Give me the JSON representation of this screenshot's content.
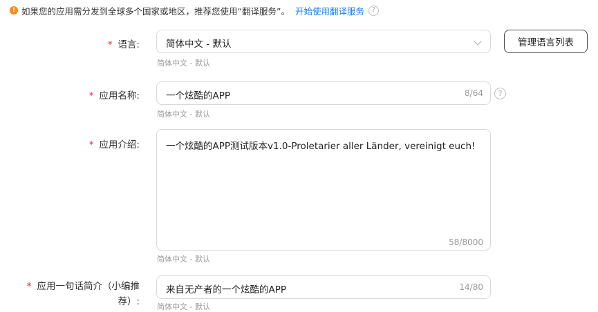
{
  "notice": {
    "text": "如果您的应用需分发到全球多个国家或地区，推荐您使用“翻译服务”。",
    "link": "开始使用翻译服务"
  },
  "language": {
    "required_mark": "*",
    "label": "语言:",
    "value": "简体中文 - 默认",
    "hint": "简体中文 - 默认",
    "manage_button": "管理语言列表"
  },
  "app_name": {
    "required_mark": "*",
    "label": "应用名称:",
    "value": "一个炫酷的APP",
    "count": "8/64",
    "hint": "简体中文 - 默认"
  },
  "app_intro": {
    "required_mark": "*",
    "label": "应用介绍:",
    "value": "一个炫酷的APP测试版本v1.0-Proletarier aller Länder, vereinigt euch!",
    "count": "58/8000",
    "hint": "简体中文 - 默认"
  },
  "app_tagline": {
    "required_mark": "*",
    "label": "应用一句话简介（小编推荐）:",
    "value": "来自无产者的一个炫酷的APP",
    "count": "14/80",
    "hint": "简体中文 - 默认"
  }
}
